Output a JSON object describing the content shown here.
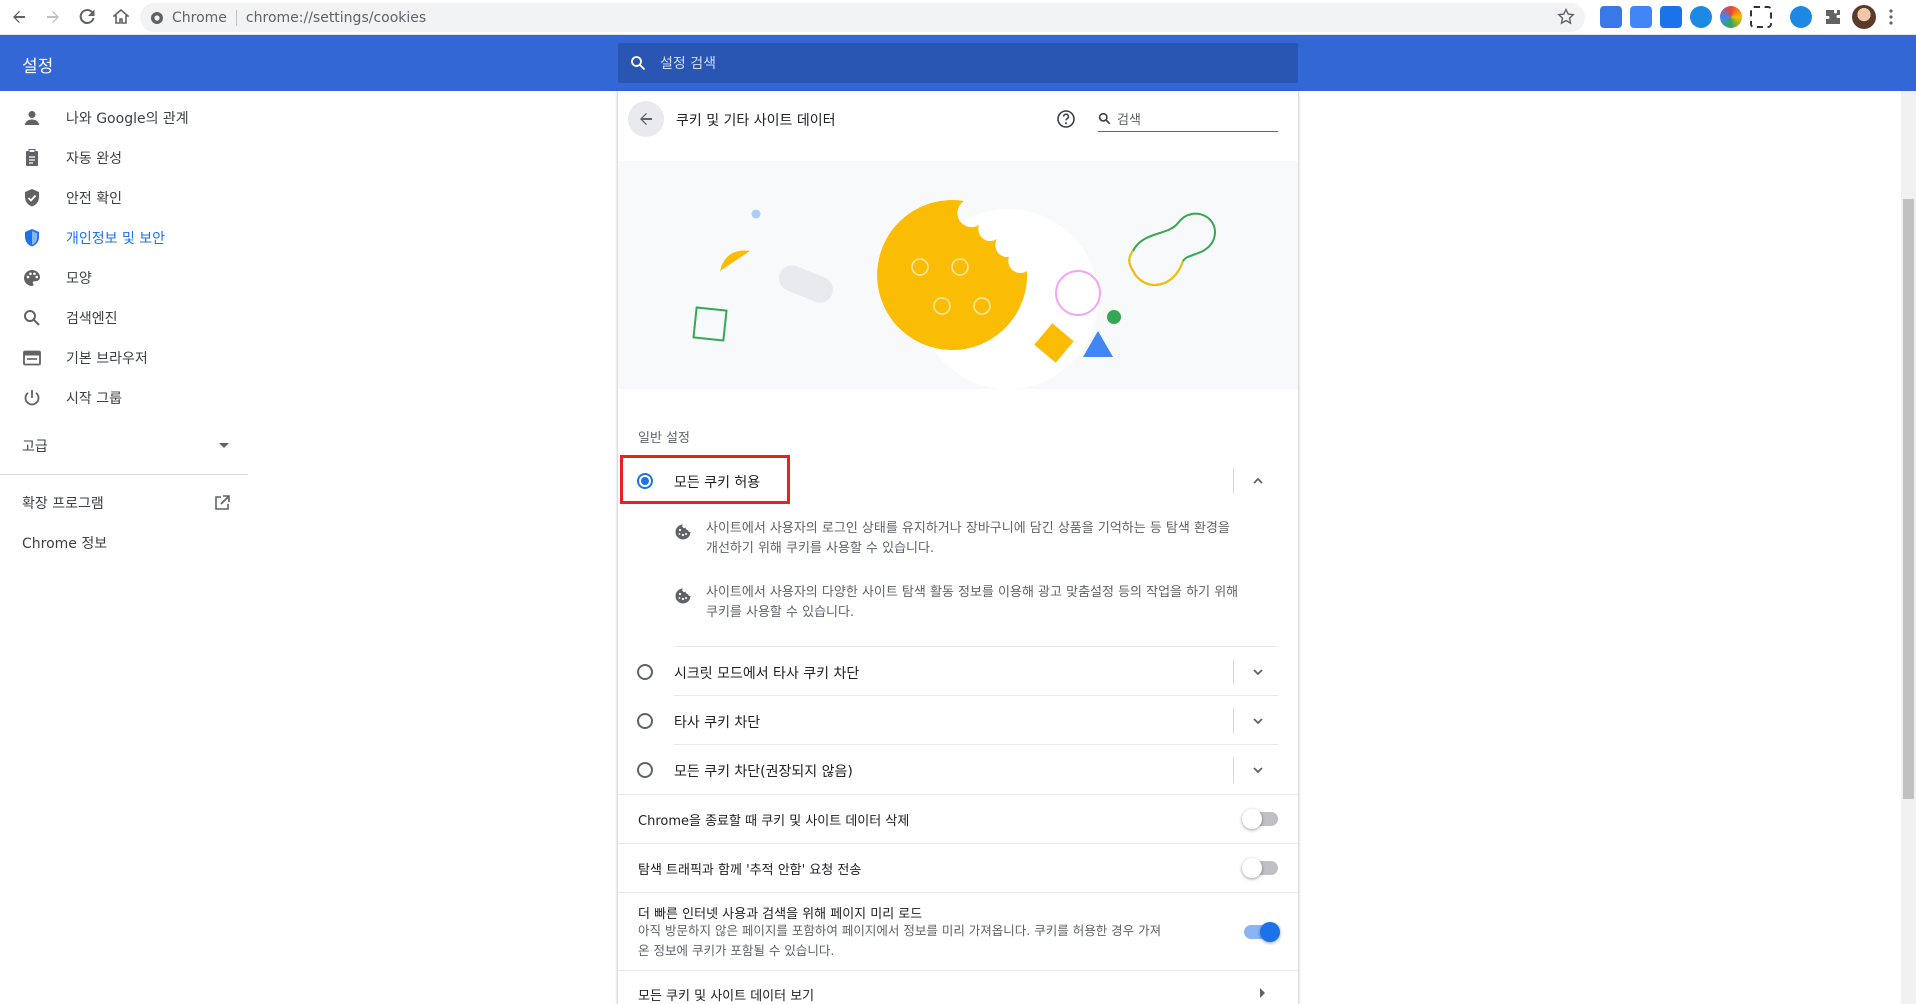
{
  "browser": {
    "site_label": "Chrome",
    "url": "chrome://settings/cookies"
  },
  "header": {
    "title": "설정",
    "search_placeholder": "설정 검색"
  },
  "sidebar": {
    "items": [
      {
        "label": "나와 Google의 관계",
        "icon": "person-icon"
      },
      {
        "label": "자동 완성",
        "icon": "clipboard-icon"
      },
      {
        "label": "안전 확인",
        "icon": "shield-check-icon"
      },
      {
        "label": "개인정보 및 보안",
        "icon": "shield-icon"
      },
      {
        "label": "모양",
        "icon": "palette-icon"
      },
      {
        "label": "검색엔진",
        "icon": "search-icon"
      },
      {
        "label": "기본 브라우저",
        "icon": "browser-icon"
      },
      {
        "label": "시작 그룹",
        "icon": "power-icon"
      }
    ],
    "advanced": "고급",
    "extensions": "확장 프로그램",
    "about": "Chrome 정보"
  },
  "page": {
    "title": "쿠키 및 기타 사이트 데이터",
    "search_placeholder": "검색",
    "general_label": "일반 설정",
    "options": [
      {
        "label": "모든 쿠키 허용",
        "selected": true
      },
      {
        "label": "시크릿 모드에서 타사 쿠키 차단",
        "selected": false
      },
      {
        "label": "타사 쿠키 차단",
        "selected": false
      },
      {
        "label": "모든 쿠키 차단(권장되지 않음)",
        "selected": false
      }
    ],
    "bullets": [
      {
        "line1": "사이트에서 사용자의 로그인 상태를 유지하거나 장바구니에 담긴 상품을 기억하는 등 탐색 환경을",
        "line2": "개선하기 위해 쿠키를 사용할 수 있습니다."
      },
      {
        "line1": "사이트에서 사용자의 다양한 사이트 탐색 활동 정보를 이용해 광고 맞춤설정 등의 작업을 하기 위해",
        "line2": "쿠키를 사용할 수 있습니다."
      }
    ],
    "rows": [
      {
        "label": "Chrome을 종료할 때 쿠키 및 사이트 데이터 삭제",
        "on": false
      },
      {
        "label": "탐색 트래픽과 함께 '추적 안함' 요청 전송",
        "on": false
      },
      {
        "label": "더 빠른 인터넷 사용과 검색을 위해 페이지 미리 로드",
        "desc1": "아직 방문하지 않은 페이지를 포함하여 페이지에서 정보를 미리 가져옵니다. 쿠키를 허용한 경우 가져",
        "desc2": "온 정보에 쿠키가 포함될 수 있습니다.",
        "on": true
      },
      {
        "label": "모든 쿠키 및 사이트 데이터 보기"
      }
    ]
  },
  "colors": {
    "accent": "#1a73e8",
    "header": "#3367d6",
    "highlight": "#e8221c"
  }
}
